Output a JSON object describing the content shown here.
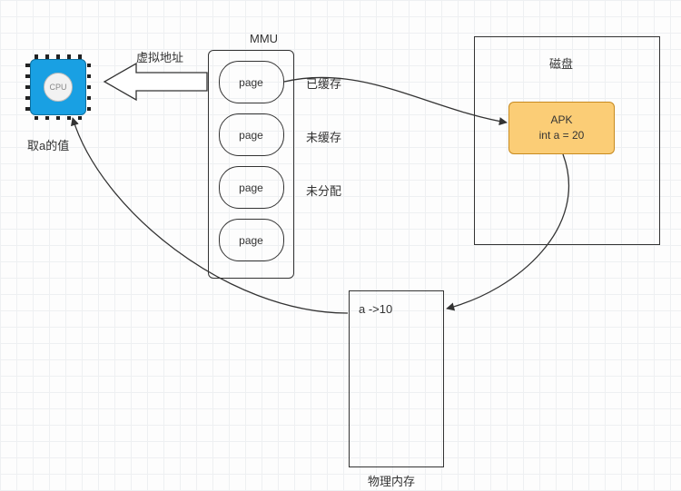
{
  "cpu": {
    "chip_label": "CPU",
    "caption": "取a的值"
  },
  "arrow_label_virtual_address": "虚拟地址",
  "mmu": {
    "title": "MMU",
    "pages": [
      "page",
      "page",
      "page",
      "page"
    ],
    "status": {
      "cached": "已缓存",
      "not_cached": "未缓存",
      "not_allocated": "未分配"
    }
  },
  "disk": {
    "title": "磁盘",
    "apk": {
      "name": "APK",
      "code": "int a = 20"
    }
  },
  "physical_memory": {
    "label": "物理内存",
    "value_line": "a ->10"
  }
}
